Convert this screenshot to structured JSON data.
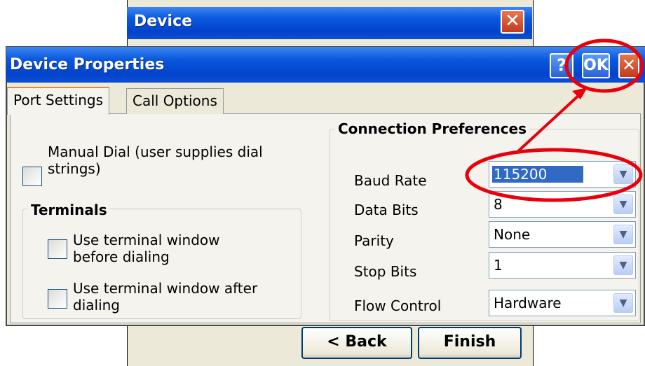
{
  "back_dialog": {
    "title": "Device",
    "close_glyph": "✕",
    "back_button": "< Back",
    "finish_button": "Finish"
  },
  "dialog": {
    "title": "Device Properties",
    "help_glyph": "?",
    "ok_label": "OK",
    "close_glyph": "✕"
  },
  "tabs": [
    {
      "label": "Port Settings",
      "active": true
    },
    {
      "label": "Call Options",
      "active": false
    }
  ],
  "manual_dial": {
    "label_line1": "Manual Dial (user supplies dial",
    "label_line2": "strings)",
    "checked": false
  },
  "terminals": {
    "title": "Terminals",
    "before": {
      "line1": "Use terminal window",
      "line2": "before dialing",
      "checked": false
    },
    "after": {
      "line1": "Use terminal window after",
      "line2": "dialing",
      "checked": false
    }
  },
  "connection": {
    "title": "Connection Preferences",
    "fields": [
      {
        "label": "Baud Rate",
        "value": "115200"
      },
      {
        "label": "Data Bits",
        "value": "8"
      },
      {
        "label": "Parity",
        "value": "None"
      },
      {
        "label": "Stop Bits",
        "value": "1"
      },
      {
        "label": "Flow Control",
        "value": "Hardware"
      }
    ]
  },
  "colors": {
    "titlebar": "#0a58df",
    "annotation": "#e8000b",
    "selection": "#316ac5"
  }
}
